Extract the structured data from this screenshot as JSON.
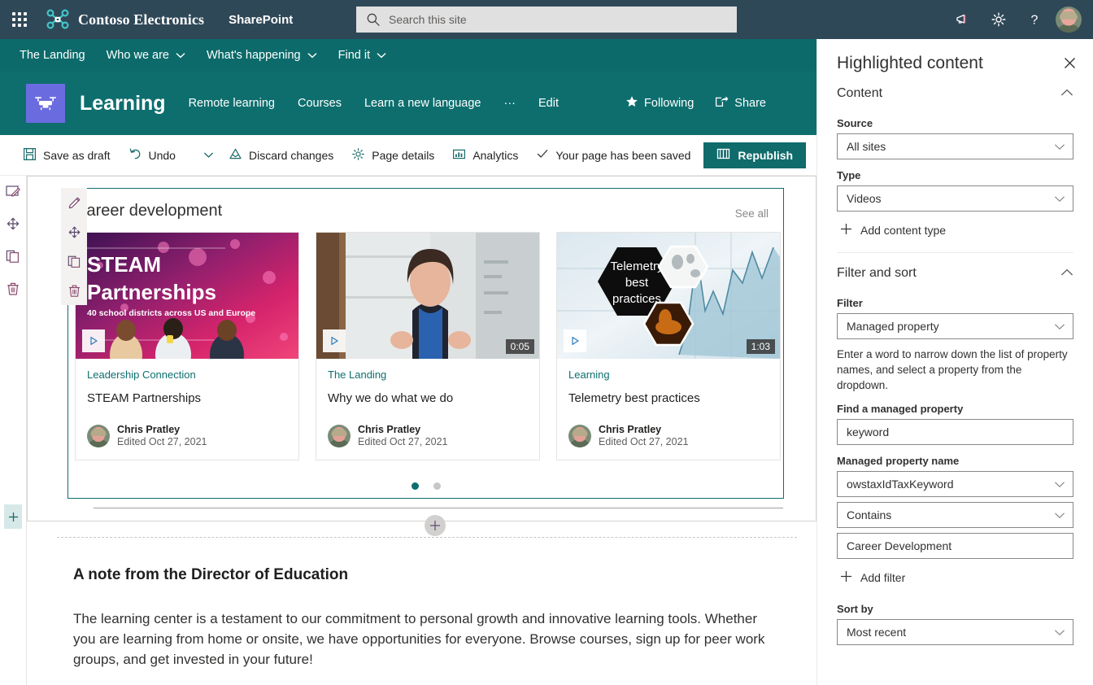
{
  "suite": {
    "waffle_label": "app-launcher",
    "brand": "Contoso Electronics",
    "app": "SharePoint",
    "search_placeholder": "Search this site",
    "search_value": "",
    "icons": [
      "megaphone-icon",
      "gear-icon",
      "help-icon",
      "avatar"
    ]
  },
  "hubnav": {
    "items": [
      {
        "label": "The Landing",
        "has_chevron": false
      },
      {
        "label": "Who we are",
        "has_chevron": true
      },
      {
        "label": "What's happening",
        "has_chevron": true
      },
      {
        "label": "Find it",
        "has_chevron": true
      }
    ]
  },
  "site": {
    "title": "Learning",
    "nav": [
      {
        "label": "Remote learning"
      },
      {
        "label": "Courses"
      },
      {
        "label": "Learn a new language"
      },
      {
        "label": "···"
      },
      {
        "label": "Edit"
      }
    ],
    "following": "Following",
    "share": "Share"
  },
  "commandbar": {
    "save_as_draft": "Save as draft",
    "undo": "Undo",
    "discard_changes": "Discard changes",
    "page_details": "Page details",
    "analytics": "Analytics",
    "saved_message": "Your page has been saved",
    "republish": "Republish"
  },
  "webpart": {
    "title": "Career development",
    "see_all": "See all",
    "cards": [
      {
        "site": "Leadership Connection",
        "title": "STEAM Partnerships",
        "author": "Chris Pratley",
        "edited": "Edited Oct 27, 2021",
        "duration": "",
        "thumb_headline": "STEAM",
        "thumb_headline2": "Partnerships",
        "thumb_sub": "40 school districts across US and Europe"
      },
      {
        "site": "The Landing",
        "title": "Why we do what we do",
        "author": "Chris Pratley",
        "edited": "Edited Oct 27, 2021",
        "duration": "0:05"
      },
      {
        "site": "Learning",
        "title": "Telemetry best practices",
        "author": "Chris Pratley",
        "edited": "Edited Oct 27, 2021",
        "duration": "1:03",
        "thumb_hex_line1": "Telemetry",
        "thumb_hex_line2": "best",
        "thumb_hex_line3": "practices"
      }
    ],
    "pager": {
      "count": 2,
      "active_index": 0
    }
  },
  "text_section": {
    "heading": "A note from the Director of Education",
    "body": "The learning center is a testament to our commitment to personal growth and innovative learning tools. Whether you are learning from home or onsite, we have opportunities for everyone. Browse courses, sign up for peer work groups, and get invested in your future!"
  },
  "rail": {
    "buttons": [
      "edit-section-icon",
      "move-icon",
      "duplicate-icon",
      "delete-icon"
    ]
  },
  "webpart_menu": {
    "buttons": [
      "edit-webpart-icon",
      "move-webpart-icon",
      "duplicate-webpart-icon",
      "delete-webpart-icon"
    ]
  },
  "pane": {
    "title": "Highlighted content",
    "sections": {
      "content": {
        "name": "Content",
        "source_label": "Source",
        "source_value": "All sites",
        "type_label": "Type",
        "type_value": "Videos",
        "add_content_type": "Add content type"
      },
      "filter_sort": {
        "name": "Filter and sort",
        "filter_label": "Filter",
        "filter_value": "Managed property",
        "hint": "Enter a word to narrow down the list of property names, and select a property from the dropdown.",
        "find_label": "Find a managed property",
        "find_value": "keyword",
        "prop_name_label": "Managed property name",
        "prop_name_value": "owstaxIdTaxKeyword",
        "operator_value": "Contains",
        "operand_value": "Career Development",
        "add_filter": "Add filter",
        "sort_label": "Sort by",
        "sort_value": "Most recent"
      }
    }
  },
  "colors": {
    "suitebar": "#2f4858",
    "hubnav": "#0c6a6a",
    "siteheader": "#0e6e6e",
    "accent": "#0e6e6e",
    "republish": "#106b6b",
    "site_logo": "#6b6be0"
  }
}
